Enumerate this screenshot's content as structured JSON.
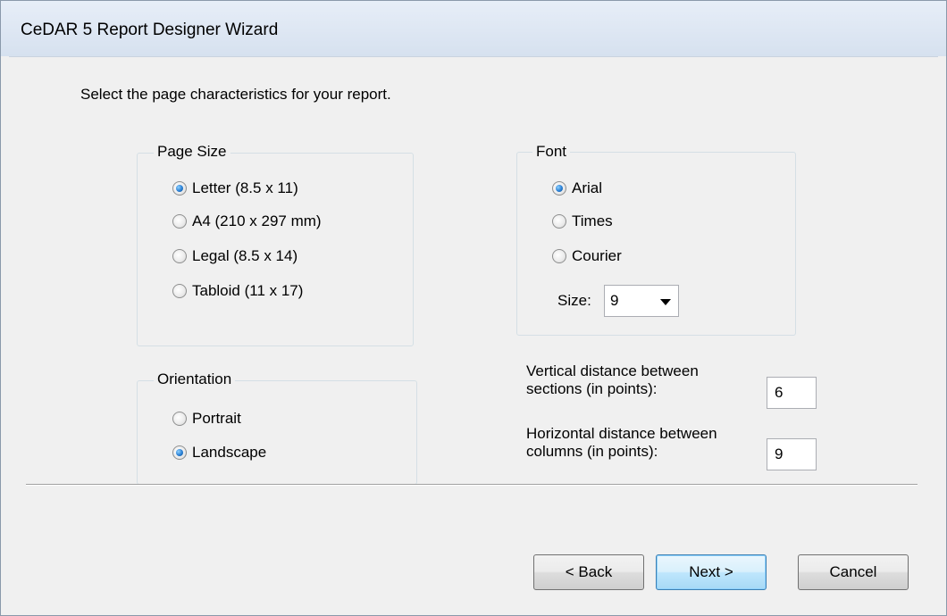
{
  "window": {
    "title": "CeDAR 5 Report Designer Wizard"
  },
  "instruction": "Select the page characteristics for your report.",
  "page_size": {
    "label": "Page Size",
    "options": [
      "Letter (8.5 x 11)",
      "A4  (210 x 297 mm)",
      "Legal (8.5 x 14)",
      "Tabloid (11 x 17)"
    ],
    "selected": "Letter (8.5 x 11)"
  },
  "orientation": {
    "label": "Orientation",
    "options": [
      "Portrait",
      "Landscape"
    ],
    "selected": "Landscape"
  },
  "font": {
    "label": "Font",
    "options": [
      "Arial",
      "Times",
      "Courier"
    ],
    "selected": "Arial",
    "size_label": "Size:",
    "size_value": "9"
  },
  "spacing": {
    "vertical_label_1": "Vertical distance between",
    "vertical_label_2": "sections (in points):",
    "vertical_value": "6",
    "horizontal_label_1": "Horizontal distance between",
    "horizontal_label_2": "columns (in points):",
    "horizontal_value": "9"
  },
  "buttons": {
    "back": "< Back",
    "next": "Next >",
    "cancel": "Cancel"
  }
}
